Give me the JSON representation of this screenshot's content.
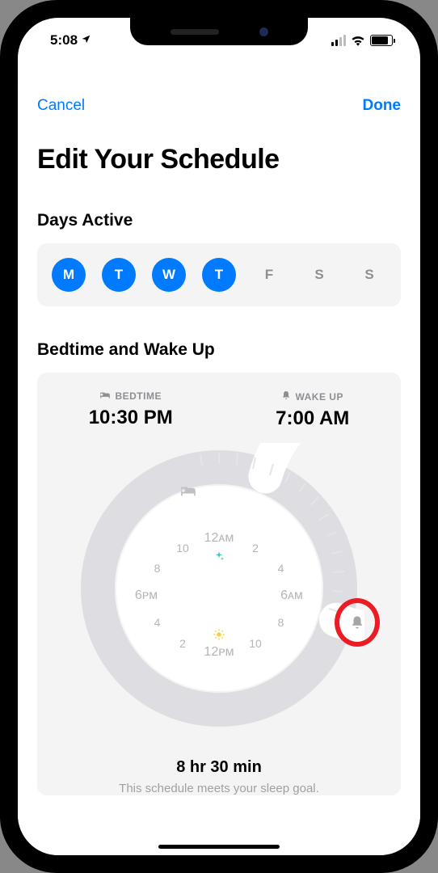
{
  "statusbar": {
    "time": "5:08"
  },
  "nav": {
    "cancel": "Cancel",
    "done": "Done"
  },
  "title": "Edit Your Schedule",
  "days": {
    "label": "Days Active",
    "items": [
      {
        "short": "M",
        "active": true
      },
      {
        "short": "T",
        "active": true
      },
      {
        "short": "W",
        "active": true
      },
      {
        "short": "T",
        "active": true
      },
      {
        "short": "F",
        "active": false
      },
      {
        "short": "S",
        "active": false
      },
      {
        "short": "S",
        "active": false
      }
    ]
  },
  "schedule": {
    "section_label": "Bedtime and Wake Up",
    "bedtime_label": "BEDTIME",
    "bedtime_value": "10:30 PM",
    "wakeup_label": "WAKE UP",
    "wakeup_value": "7:00 AM",
    "duration": "8 hr 30 min",
    "goal_text": "This schedule meets your sleep goal."
  },
  "clock": {
    "twelve_am": "12ᴀᴍ",
    "six_am": "6ᴀᴍ",
    "twelve_pm": "12ᴘᴍ",
    "six_pm": "6ᴘᴍ",
    "h2": "2",
    "h4": "4",
    "h8": "8",
    "h10": "10"
  }
}
